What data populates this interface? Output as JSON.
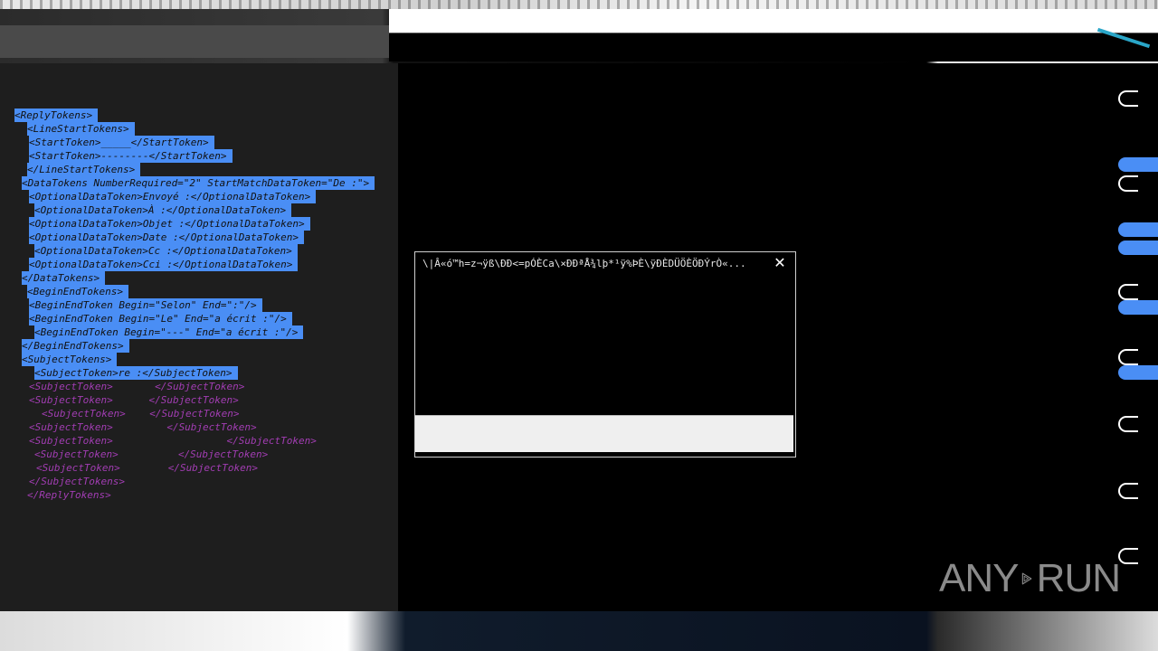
{
  "window": {
    "title": "",
    "bottom_label": "",
    "menu_scrap": ""
  },
  "editor": {
    "lines": [
      {
        "text": "<ReplyTokens>",
        "selected": true
      },
      {
        "text": "  <LineStartTokens>",
        "selected": true
      },
      {
        "text": "    <StartToken>_____</StartToken>",
        "selected": true
      },
      {
        "text": "    <StartToken>--------</StartToken>",
        "selected": true
      },
      {
        "text": "  </LineStartTokens>",
        "selected": true
      },
      {
        "text": "  <DataTokens NumberRequired=\"2\" StartMatchDataToken=\"De :\">",
        "selected": true
      },
      {
        "text": "    <OptionalDataToken>Envoyé :</OptionalDataToken>",
        "selected": true
      },
      {
        "text": "    <OptionalDataToken>À :</OptionalDataToken>",
        "selected": true
      },
      {
        "text": "    <OptionalDataToken>Objet :</OptionalDataToken>",
        "selected": true
      },
      {
        "text": "    <OptionalDataToken>Date :</OptionalDataToken>",
        "selected": true
      },
      {
        "text": "    <OptionalDataToken>Cc :</OptionalDataToken>",
        "selected": true
      },
      {
        "text": "    <OptionalDataToken>Cci :</OptionalDataToken>",
        "selected": true
      },
      {
        "text": "  </DataTokens>",
        "selected": true
      },
      {
        "text": "  <BeginEndTokens>",
        "selected": true
      },
      {
        "text": "    <BeginEndToken Begin=\"Selon\" End=\":\"/>",
        "selected": true
      },
      {
        "text": "    <BeginEndToken Begin=\"Le\" End=\"a écrit :\"/>",
        "selected": true
      },
      {
        "text": "    <BeginEndToken Begin=\"---\" End=\"a écrit :\"/>",
        "selected": true
      },
      {
        "text": "  </BeginEndTokens>",
        "selected": true
      },
      {
        "text": "  <SubjectTokens>",
        "selected": true
      },
      {
        "text": "    <SubjectToken>re :</SubjectToken>",
        "selected": true
      },
      {
        "text": "    <SubjectToken>       </SubjectToken>",
        "selected": false
      },
      {
        "text": "    <SubjectToken>      </SubjectToken>",
        "selected": false
      },
      {
        "text": "      <SubjectToken>    </SubjectToken>",
        "selected": false
      },
      {
        "text": "    <SubjectToken>         </SubjectToken>",
        "selected": false
      },
      {
        "text": "    <SubjectToken>                   </SubjectToken>",
        "selected": false
      },
      {
        "text": "    <SubjectToken>          </SubjectToken>",
        "selected": false
      },
      {
        "text": "      <SubjectToken>        </SubjectToken>",
        "selected": false
      },
      {
        "text": "    </SubjectTokens>",
        "selected": false
      },
      {
        "text": "  </ReplyTokens>",
        "selected": false
      }
    ]
  },
  "dialog": {
    "title": "\\|Â«ó™h=z¬ÿß\\ÐÐ<=pÓÈCa\\×ÐÐªÅ¾lþ*¹ÿ%ÞÈ\\ÿÐÈDÜÖÈÖÐÝrÒ«...",
    "close_symbol": "✕",
    "input_value": ""
  },
  "watermark": {
    "left": "ANY",
    "right": "RUN"
  }
}
